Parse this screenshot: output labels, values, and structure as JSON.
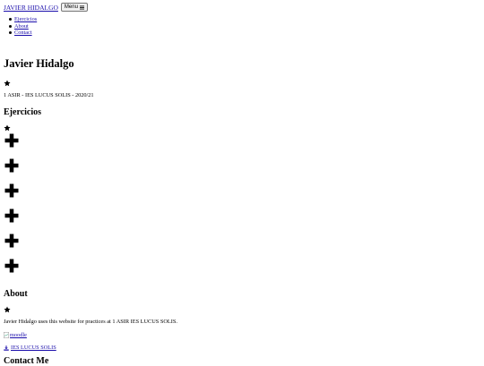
{
  "navbar": {
    "brand": "JAVIER HIDALGO",
    "menu_label": "Menu",
    "menu_icon": "bars-icon",
    "items": [
      {
        "label": "Ejercicios"
      },
      {
        "label": "About"
      },
      {
        "label": "Contact"
      }
    ]
  },
  "header": {
    "title": "Javier Hidalgo",
    "icon": "star-icon",
    "subtitle": "1 ASIR - IES LUCUS SOLIS - 2020/21"
  },
  "ejercicios": {
    "title": "Ejercicios",
    "icon": "star-icon",
    "items": [
      {
        "icon": "plus-icon"
      },
      {
        "icon": "plus-icon"
      },
      {
        "icon": "plus-icon"
      },
      {
        "icon": "plus-icon"
      },
      {
        "icon": "plus-icon"
      },
      {
        "icon": "plus-icon"
      }
    ]
  },
  "about": {
    "title": "About",
    "icon": "star-icon",
    "text": "Javier Hidalgo uses this website for practices at 1 ASIR IES LUCUS SOLIS.",
    "image_alt": "moodle",
    "link_label": "IES LUCUS SOLIS",
    "link_icon": "download-icon"
  },
  "contact": {
    "title": "Contact Me"
  }
}
